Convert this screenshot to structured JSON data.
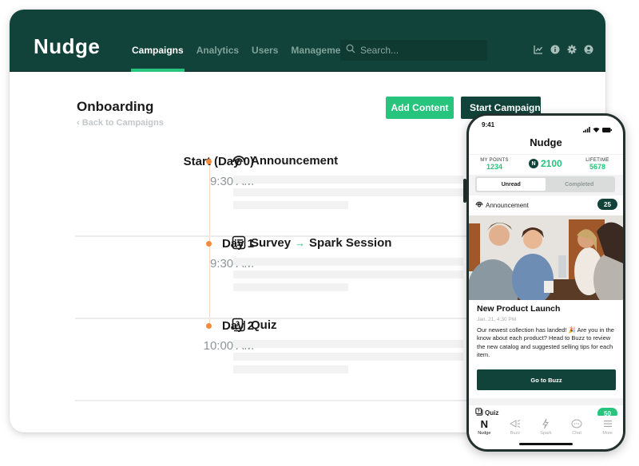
{
  "app": {
    "logo": "Nudge",
    "nav": [
      {
        "label": "Campaigns",
        "active": true
      },
      {
        "label": "Analytics",
        "active": false
      },
      {
        "label": "Users",
        "active": false
      },
      {
        "label": "Management",
        "active": false
      }
    ],
    "search": {
      "placeholder": "Search...",
      "value": ""
    },
    "header_icons": [
      "analytics-icon",
      "info-icon",
      "settings-icon",
      "account-icon"
    ],
    "colors": {
      "brand_dark": "#12433a",
      "accent_green": "#26c47c",
      "timeline_orange": "#f58a3c"
    }
  },
  "page": {
    "title": "Onboarding",
    "back_link": "Back to Campaigns",
    "add_content_label": "Add Content",
    "start_campaign_label": "Start Campaign"
  },
  "steps": [
    {
      "day": "Start (Day 0)",
      "time": "9:30 AM",
      "icon": "announcement-icon",
      "title": "Announcement",
      "title_suffix": ""
    },
    {
      "day": "Day 1",
      "time": "9:30 AM",
      "icon": "survey-icon",
      "title": "Survey",
      "arrow": "→",
      "title_suffix": "Spark Session"
    },
    {
      "day": "Day 2",
      "time": "10:00 AM",
      "icon": "quiz-icon",
      "title": "Quiz",
      "title_suffix": ""
    }
  ],
  "phone": {
    "time": "9:41",
    "title": "Nudge",
    "points": {
      "my_points_label": "MY POINTS",
      "my_points": "1234",
      "badge": "N",
      "current": "2100",
      "lifetime_label": "LIFETIME",
      "lifetime": "5678"
    },
    "tabs": [
      {
        "label": "Unread",
        "active": true
      },
      {
        "label": "Completed",
        "active": false
      }
    ],
    "announcement": {
      "label": "Announcement",
      "count": "25"
    },
    "card": {
      "title": "New Product Launch",
      "date": "Jan. 21, 4:30 PM",
      "body": "Our newest collection has landed! 🎉 Are you in the know about each product? Head to Buzz to review the new catalog and suggested selling tips for each item.",
      "button": "Go to Buzz"
    },
    "quiz": {
      "label": "Quiz",
      "count": "50"
    },
    "tabbar": [
      {
        "label": "Nudge",
        "icon": "nudge-logo-icon",
        "active": true
      },
      {
        "label": "Buzz",
        "icon": "megaphone-icon",
        "active": false
      },
      {
        "label": "Spark",
        "icon": "lightning-icon",
        "active": false
      },
      {
        "label": "Chat",
        "icon": "chat-icon",
        "active": false
      },
      {
        "label": "More",
        "icon": "menu-icon",
        "active": false
      }
    ]
  }
}
